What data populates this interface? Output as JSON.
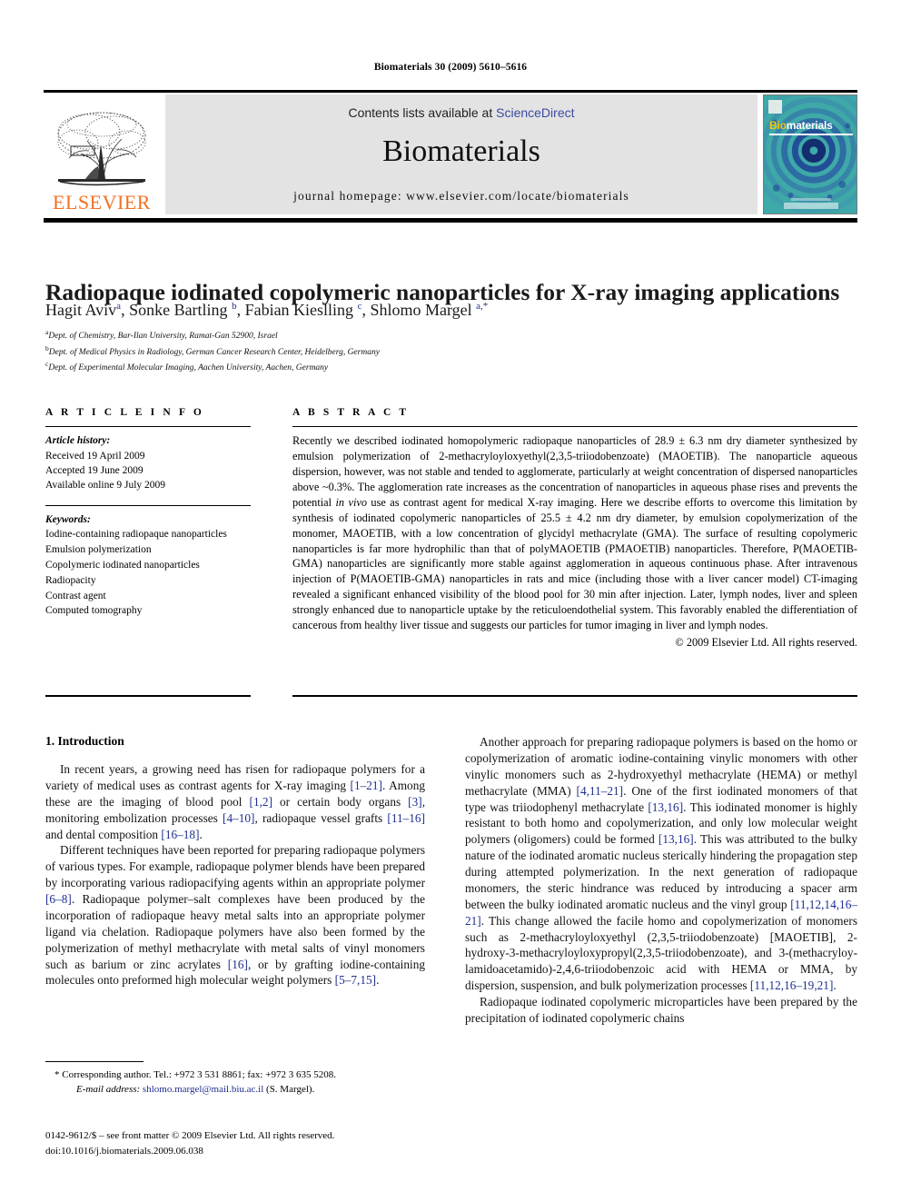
{
  "running_head": "Biomaterials 30 (2009) 5610–5616",
  "banner": {
    "publisher_logo_text": "ELSEVIER",
    "contents_prefix": "Contents lists available at ",
    "contents_link": "ScienceDirect",
    "journal_name": "Biomaterials",
    "homepage": "journal homepage: www.elsevier.com/locate/biomaterials",
    "cover": {
      "title_part1": "Bio",
      "title_part2": "materials"
    },
    "colors": {
      "link": "#3b4ba0",
      "elsevier_orange": "#F37021",
      "banner_bg": "#e3e3e3",
      "cover_teal": "#3fa8a8",
      "cover_blue": "#1d3f9e"
    }
  },
  "article": {
    "title": "Radiopaque iodinated copolymeric nanoparticles for X-ray imaging applications",
    "authors_html": "Hagit Aviv<sup>a</sup>, Sonke Bartling <sup>b</sup>, Fabian Kieslling <sup>c</sup>, Shlomo Margel <sup>a,*</sup>",
    "authors_plain": "Hagit Aviv a, Sonke Bartling b, Fabian Kieslling c, Shlomo Margel a,*",
    "affiliations": [
      {
        "marker": "a",
        "text": "Dept. of Chemistry, Bar-Ilan University, Ramat-Gan 52900, Israel"
      },
      {
        "marker": "b",
        "text": "Dept. of Medical Physics in Radiology, German Cancer Research Center, Heidelberg, Germany"
      },
      {
        "marker": "c",
        "text": "Dept. of Experimental Molecular Imaging, Aachen University, Aachen, Germany"
      }
    ]
  },
  "article_info": {
    "heading": "A R T I C L E  I N F O",
    "history_label": "Article history:",
    "history": [
      "Received 19 April 2009",
      "Accepted 19 June 2009",
      "Available online 9 July 2009"
    ],
    "keywords_label": "Keywords:",
    "keywords": [
      "Iodine-containing radiopaque nanoparticles",
      "Emulsion polymerization",
      "Copolymeric iodinated nanoparticles",
      "Radiopacity",
      "Contrast agent",
      "Computed tomography"
    ]
  },
  "abstract": {
    "heading": "A B S T R A C T",
    "text": "Recently we described iodinated homopolymeric radiopaque nanoparticles of 28.9 ± 6.3 nm dry diameter synthesized by emulsion polymerization of 2-methacryloyloxyethyl(2,3,5-triiodobenzoate) (MAOETIB). The nanoparticle aqueous dispersion, however, was not stable and tended to agglomerate, particularly at weight concentration of dispersed nanoparticles above ~0.3%. The agglomeration rate increases as the concentration of nanoparticles in aqueous phase rises and prevents the potential in vivo use as contrast agent for medical X-ray imaging. Here we describe efforts to overcome this limitation by synthesis of iodinated copolymeric nanoparticles of 25.5 ± 4.2 nm dry diameter, by emulsion copolymerization of the monomer, MAOETIB, with a low concentration of glycidyl methacrylate (GMA). The surface of resulting copolymeric nanoparticles is far more hydrophilic than that of polyMAOETIB (PMAOETIB) nanoparticles. Therefore, P(MAOETIB-GMA) nanoparticles are significantly more stable against agglomeration in aqueous continuous phase. After intravenous injection of P(MAOETIB-GMA) nanoparticles in rats and mice (including those with a liver cancer model) CT-imaging revealed a significant enhanced visibility of the blood pool for 30 min after injection. Later, lymph nodes, liver and spleen strongly enhanced due to nanoparticle uptake by the reticuloendothelial system. This favorably enabled the differentiation of cancerous from healthy liver tissue and suggests our particles for tumor imaging in liver and lymph nodes.",
    "text_html": "Recently we described iodinated homopolymeric radiopaque nanoparticles of 28.9 ± 6.3 nm dry diameter synthesized by emulsion polymerization of 2-methacryloyloxyethyl(2,3,5-triiodobenzoate) (MAOETIB). The nanoparticle aqueous dispersion, however, was not stable and tended to agglomerate, particularly at weight concentration of dispersed nanoparticles above ~0.3%. The agglomeration rate increases as the concentration of nanoparticles in aqueous phase rises and prevents the potential <i>in vivo</i> use as contrast agent for medical X-ray imaging. Here we describe efforts to overcome this limitation by synthesis of iodinated copolymeric nanoparticles of 25.5 ± 4.2 nm dry diameter, by emulsion copolymerization of the monomer, MAOETIB, with a low concentration of glycidyl methacrylate (GMA). The surface of resulting copolymeric nanoparticles is far more hydrophilic than that of polyMAOETIB (PMAOETIB) nanoparticles. Therefore, P(MAOETIB-GMA) nanoparticles are significantly more stable against agglomeration in aqueous continuous phase. After intravenous injection of P(MAOETIB-GMA) nanoparticles in rats and mice (including those with a liver cancer model) CT-imaging revealed a significant enhanced visibility of the blood pool for 30 min after injection. Later, lymph nodes, liver and spleen strongly enhanced due to nanoparticle uptake by the reticuloendothelial system. This favorably enabled the differentiation of cancerous from healthy liver tissue and suggests our particles for tumor imaging in liver and lymph nodes.",
    "copyright": "© 2009 Elsevier Ltd. All rights reserved."
  },
  "body": {
    "section_heading": "1. Introduction",
    "left_paragraphs_html": [
      "In recent years, a growing need has risen for radiopaque polymers for a variety of medical uses as contrast agents for X-ray imaging <span class=\"ref\">[1–21]</span>. Among these are the imaging of blood pool <span class=\"ref\">[1,2]</span> or certain body organs <span class=\"ref\">[3]</span>, monitoring embolization processes <span class=\"ref\">[4–10]</span>, radiopaque vessel grafts <span class=\"ref\">[11–16]</span> and dental composition <span class=\"ref\">[16–18]</span>.",
      "Different techniques have been reported for preparing radiopaque polymers of various types. For example, radiopaque polymer blends have been prepared by incorporating various radiopacifying agents within an appropriate polymer <span class=\"ref\">[6–8]</span>. Radiopaque polymer–salt complexes have been produced by the incorporation of radiopaque heavy metal salts into an appropriate polymer ligand via chelation. Radiopaque polymers have also been formed by the polymerization of methyl methacrylate with metal salts of vinyl monomers such as barium or zinc acrylates <span class=\"ref\">[16]</span>, or by grafting iodine-containing molecules onto preformed high molecular weight polymers <span class=\"ref\">[5–7,15]</span>."
    ],
    "right_paragraphs_html": [
      "Another approach for preparing radiopaque polymers is based on the homo or copolymerization of aromatic iodine-containing vinylic monomers with other vinylic monomers such as 2-hydroxyethyl methacrylate (HEMA) or methyl methacrylate (MMA) <span class=\"ref\">[4,11–21]</span>. One of the first iodinated monomers of that type was triiodophenyl methacrylate <span class=\"ref\">[13,16]</span>. This iodinated monomer is highly resistant to both homo and copolymerization, and only low molecular weight polymers (oligomers) could be formed <span class=\"ref\">[13,16]</span>. This was attributed to the bulky nature of the iodinated aromatic nucleus sterically hindering the propagation step during attempted polymerization. In the next generation of radiopaque monomers, the steric hindrance was reduced by introducing a spacer arm between the bulky iodinated aromatic nucleus and the vinyl group <span class=\"ref\">[11,12,14,16–21]</span>. This change allowed the facile homo and copolymerization of monomers such as 2-methacryloyloxyethyl (2,3,5-triiodobenzoate) [MAOETIB], 2-hydroxy-3-methacryloyloxypropyl(2,3,5-triiodobenzoate), and 3-(methacryloy-lamidoacetamido)-2,4,6-triiodobenzoic acid with HEMA or MMA, by dispersion, suspension, and bulk polymerization processes <span class=\"ref\">[11,12,16–19,21]</span>.",
      "Radiopaque iodinated copolymeric microparticles have been prepared by the precipitation of iodinated copolymeric chains"
    ]
  },
  "footnote": {
    "star": "*",
    "corresponding_html": "Corresponding author. Tel.: +972 3 531 8861; fax: +972 3 635 5208.",
    "email_label": "E-mail address:",
    "email": "shlomo.margel@mail.biu.ac.il",
    "email_suffix": "(S. Margel)."
  },
  "imprint": {
    "line1": "0142-9612/$ – see front matter © 2009 Elsevier Ltd. All rights reserved.",
    "line2": "doi:10.1016/j.biomaterials.2009.06.038"
  }
}
